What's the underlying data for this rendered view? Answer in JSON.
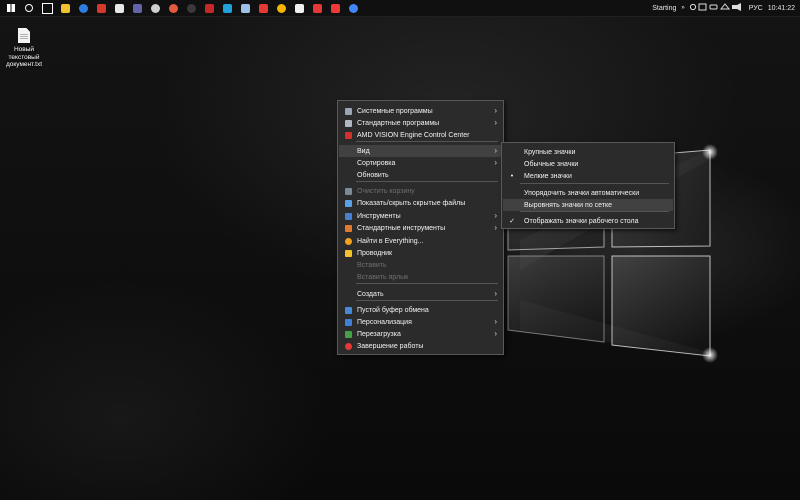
{
  "taskbar": {
    "apps": [
      {
        "icon": "windows-start-icon",
        "color": "#ffffff"
      },
      {
        "icon": "search-icon",
        "color": "#ffffff"
      },
      {
        "icon": "task-view-icon",
        "color": "#ffffff"
      },
      {
        "icon": "file-explorer-icon",
        "color": "#f2c12e"
      },
      {
        "icon": "browser-blue-icon",
        "color": "#2f7de1"
      },
      {
        "icon": "photos-icon",
        "color": "#d33a2c"
      },
      {
        "icon": "notepad-icon",
        "color": "#e8e8e8"
      },
      {
        "icon": "teams-icon",
        "color": "#6264a7"
      },
      {
        "icon": "obs-icon",
        "color": "#cfcfcf"
      },
      {
        "icon": "media-player-icon",
        "color": "#e35b3e"
      },
      {
        "icon": "record-icon",
        "color": "#3a3a3a"
      },
      {
        "icon": "red-app-icon",
        "color": "#c62828"
      },
      {
        "icon": "edge-icon",
        "color": "#1fa1d9"
      },
      {
        "icon": "network-app-icon",
        "color": "#9ec0e6"
      },
      {
        "icon": "tools-icon",
        "color": "#e53935"
      },
      {
        "icon": "globe-yellow-icon",
        "color": "#f4b400"
      },
      {
        "icon": "rss-icon",
        "color": "#f0f0f0"
      },
      {
        "icon": "yandex-icon",
        "color": "#e53935"
      },
      {
        "icon": "vivaldi-icon",
        "color": "#ef3939"
      },
      {
        "icon": "chrome-icon",
        "color": "#4285f4"
      }
    ],
    "tray": {
      "status": "Starting",
      "chevrons": "»",
      "language": "РУС",
      "time": "10:41:22"
    }
  },
  "desktop": {
    "icon_label_lines": [
      "Новый",
      "текстовый",
      "документ.txt"
    ]
  },
  "context_menu": {
    "items": [
      {
        "label": "Системные программы",
        "icon": "system-programs-icon",
        "submenu": true
      },
      {
        "label": "Стандартные программы",
        "icon": "standard-programs-icon",
        "submenu": true
      },
      {
        "label": "AMD VISION Engine Control Center",
        "icon": "amd-icon"
      },
      {
        "label": "Вид",
        "submenu": true,
        "highlighted": true
      },
      {
        "label": "Сортировка",
        "submenu": true
      },
      {
        "label": "Обновить"
      },
      {
        "label": "Очистить корзину",
        "icon": "recycle-bin-icon",
        "disabled": true
      },
      {
        "label": "Показать/скрыть скрытые файлы",
        "icon": "hidden-files-icon"
      },
      {
        "label": "Инструменты",
        "icon": "tools-icon",
        "submenu": true
      },
      {
        "label": "Стандартные инструменты",
        "icon": "wrench-icon",
        "submenu": true
      },
      {
        "label": "Найти в Everything...",
        "icon": "everything-search-icon"
      },
      {
        "label": "Проводник",
        "icon": "explorer-folder-icon"
      },
      {
        "label": "Вставить",
        "disabled": true
      },
      {
        "label": "Вставить ярлык",
        "disabled": true
      },
      {
        "label": "Создать",
        "submenu": true
      },
      {
        "label": "Пустой буфер обмена",
        "icon": "clipboard-icon"
      },
      {
        "label": "Персонализация",
        "icon": "personalization-icon",
        "submenu": true
      },
      {
        "label": "Перезагрузка",
        "icon": "restart-icon",
        "submenu": true
      },
      {
        "label": "Завершение работы",
        "icon": "shutdown-icon"
      }
    ]
  },
  "view_submenu": {
    "items": [
      {
        "label": "Крупные значки"
      },
      {
        "label": "Обычные значки"
      },
      {
        "label": "Мелкие значки",
        "mark": "•"
      },
      {
        "label": "Упорядочить значки автоматически"
      },
      {
        "label": "Выровнять значки по сетке",
        "highlighted": true
      },
      {
        "label": "Отображать значки рабочего стола",
        "mark": "✓"
      }
    ]
  }
}
